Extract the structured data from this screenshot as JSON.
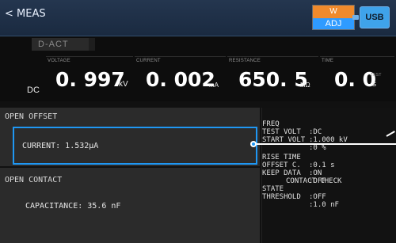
{
  "header": {
    "back_label": "< MEAS",
    "mode_top": "W",
    "mode_bottom": "ADJ",
    "usb_label": "USB"
  },
  "meas": {
    "state_label": "D-ACT",
    "dc_label": "DC",
    "voltage": {
      "label": "VOLTAGE",
      "value": "0. 997",
      "unit": "kV"
    },
    "current": {
      "label": "CURRENT",
      "value": "0. 002",
      "unit": "mA"
    },
    "resistance": {
      "label": "RESISTANCE",
      "value": "650. 5",
      "unit": "MΩ"
    },
    "time": {
      "label": "TIME",
      "value": "0. 0",
      "unit": "s",
      "tag": "TEST"
    }
  },
  "open_offset": {
    "title": "OPEN OFFSET",
    "current_text": "CURRENT: 1.532μA"
  },
  "open_contact": {
    "title": "OPEN CONTACT",
    "capacitance_text": "CAPACITANCE:  35.6 nF"
  },
  "settings": {
    "freq_key": "FREQ",
    "freq_val": ":DC",
    "test_volt_key": "TEST VOLT",
    "test_volt_val": ":1.000 kV",
    "start_volt_key": "START VOLT",
    "start_volt_val": ":0 %",
    "rise_time_key": "RISE TIME",
    "rise_time_val": ":0.1 s",
    "offset_key": "OFFSET C.",
    "offset_val": ":ON",
    "keep_data_key": "KEEP DATA",
    "keep_data_val": ":OFF",
    "contact_check_label": "CONTACT CHECK",
    "state_key": "STATE",
    "state_val": ":OFF",
    "threshold_key": "THRESHOLD",
    "threshold_val": ":1.0 nF"
  }
}
